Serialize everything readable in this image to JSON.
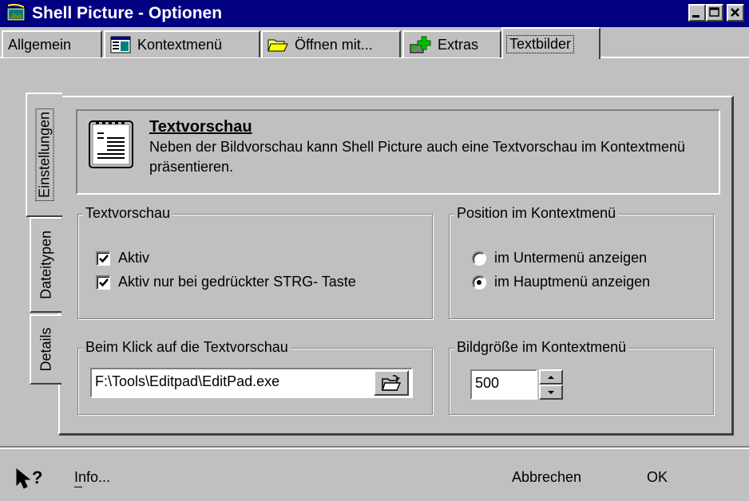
{
  "window": {
    "title": "Shell Picture - Optionen",
    "icon": "shell-picture-app-icon",
    "controls": [
      "minimize-icon",
      "maximize-icon",
      "close-icon"
    ]
  },
  "tabs": [
    {
      "label": "Allgemein",
      "icon": null,
      "active": false
    },
    {
      "label": "Kontextmenü",
      "icon": "context-menu-icon",
      "active": false
    },
    {
      "label": "Öffnen mit...",
      "icon": "folder-open-icon",
      "active": false
    },
    {
      "label": "Extras",
      "icon": "extras-icon",
      "active": false
    },
    {
      "label": "Textbilder",
      "icon": null,
      "active": true
    }
  ],
  "side_tabs": [
    {
      "label": "Einstellungen",
      "active": true
    },
    {
      "label": "Dateitypen",
      "active": false
    },
    {
      "label": "Details",
      "active": false
    }
  ],
  "info": {
    "icon": "text-document-icon",
    "title": "Textvorschau",
    "text": "Neben der Bildvorschau kann Shell Picture auch eine Textvorschau im Kontextmenü präsentieren."
  },
  "textvorschau_group": {
    "legend": "Textvorschau",
    "options": [
      {
        "label": "Aktiv",
        "checked": true
      },
      {
        "label": "Aktiv nur bei gedrückter STRG- Taste",
        "checked": true
      }
    ]
  },
  "position_group": {
    "legend": "Position im Kontextmenü",
    "options": [
      {
        "label": "im Untermenü anzeigen",
        "selected": false
      },
      {
        "label": "im Hauptmenü anzeigen",
        "selected": true
      }
    ]
  },
  "click_group": {
    "legend": "Beim Klick auf die Textvorschau",
    "path_value": "F:\\Tools\\Editpad\\EditPad.exe",
    "browse_icon": "browse-folder-icon"
  },
  "size_group": {
    "legend": "Bildgröße im Kontextmenü",
    "value": "500"
  },
  "footer": {
    "help_icon": "whats-this-help-icon",
    "info_label": "Info...",
    "cancel_label": "Abbrechen",
    "ok_label": "OK"
  }
}
